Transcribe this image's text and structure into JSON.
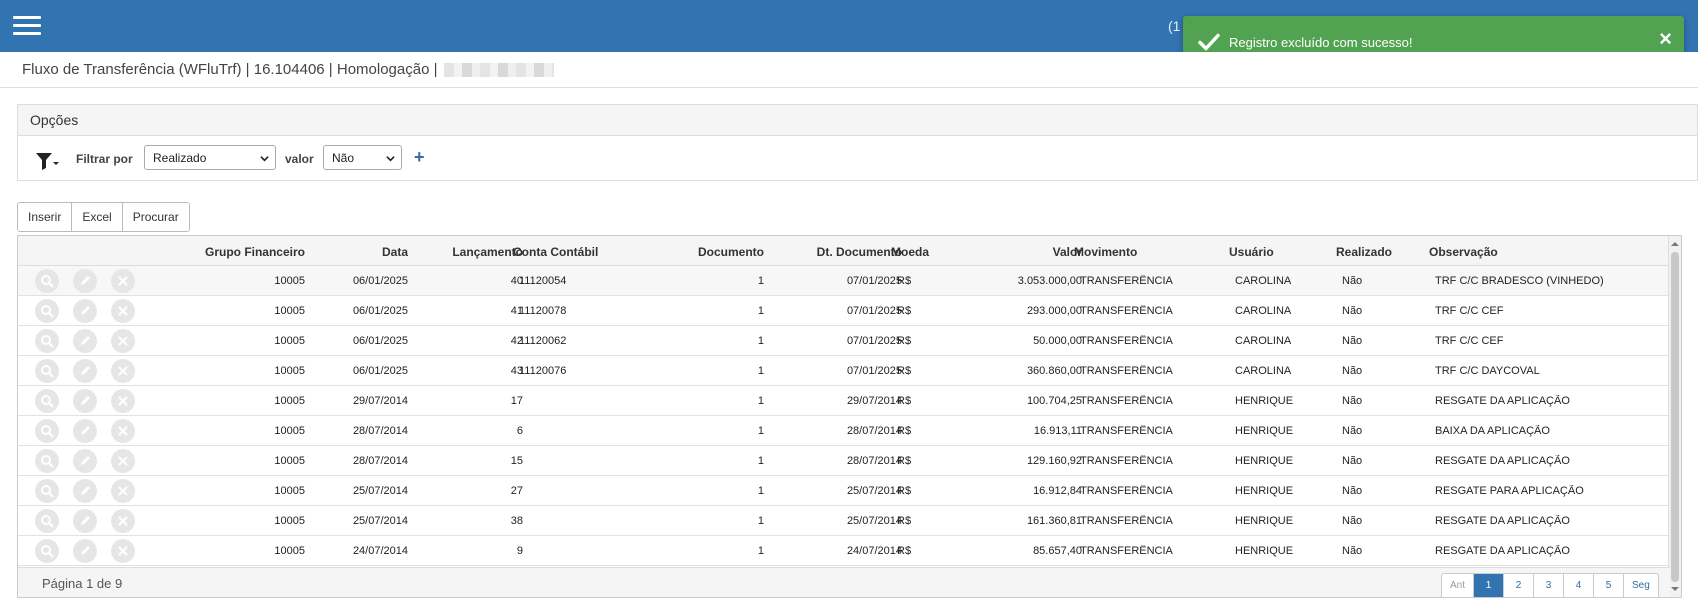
{
  "topbar": {
    "extra_text": "(1"
  },
  "toast": {
    "message": "Registro excluído com sucesso!",
    "close_label": "×",
    "color": "#51a351"
  },
  "page_title": "Fluxo de Transferência (WFluTrf) | 16.104406 | Homologação |",
  "options": {
    "heading": "Opções",
    "filter_label": "Filtrar por",
    "filter_field": "Realizado",
    "value_label": "valor",
    "filter_value": "Não",
    "add_label": "+"
  },
  "toolbar": {
    "insert_label": "Inserir",
    "excel_label": "Excel",
    "search_label": "Procurar"
  },
  "table": {
    "headers": {
      "grupo": "Grupo Financeiro",
      "data": "Data",
      "lancamento": "Lançamento",
      "conta": "Conta Contábil",
      "documento": "Documento",
      "dt_documento": "Dt. Documento",
      "moeda": "Moeda",
      "valor": "Valor",
      "movimento": "Movimento",
      "usuario": "Usuário",
      "realizado": "Realizado",
      "observacao": "Observação"
    },
    "rows": [
      {
        "grupo": "10005",
        "data": "06/01/2025",
        "lancamento": "40",
        "conta": "11120054",
        "documento": "1",
        "dt_documento": "07/01/2025",
        "moeda": "R$",
        "valor": "3.053.000,00",
        "movimento": "TRANSFERÊNCIA",
        "usuario": "CAROLINA",
        "realizado": "Não",
        "observacao": "TRF C/C BRADESCO (VINHEDO)"
      },
      {
        "grupo": "10005",
        "data": "06/01/2025",
        "lancamento": "41",
        "conta": "11120078",
        "documento": "1",
        "dt_documento": "07/01/2025",
        "moeda": "R$",
        "valor": "293.000,00",
        "movimento": "TRANSFERÊNCIA",
        "usuario": "CAROLINA",
        "realizado": "Não",
        "observacao": "TRF C/C CEF"
      },
      {
        "grupo": "10005",
        "data": "06/01/2025",
        "lancamento": "42",
        "conta": "11120062",
        "documento": "1",
        "dt_documento": "07/01/2025",
        "moeda": "R$",
        "valor": "50.000,00",
        "movimento": "TRANSFERÊNCIA",
        "usuario": "CAROLINA",
        "realizado": "Não",
        "observacao": "TRF C/C CEF"
      },
      {
        "grupo": "10005",
        "data": "06/01/2025",
        "lancamento": "43",
        "conta": "11120076",
        "documento": "1",
        "dt_documento": "07/01/2025",
        "moeda": "R$",
        "valor": "360.860,00",
        "movimento": "TRANSFERÊNCIA",
        "usuario": "CAROLINA",
        "realizado": "Não",
        "observacao": "TRF C/C DAYCOVAL"
      },
      {
        "grupo": "10005",
        "data": "29/07/2014",
        "lancamento": "17",
        "conta": "",
        "documento": "1",
        "dt_documento": "29/07/2014",
        "moeda": "R$",
        "valor": "100.704,25",
        "movimento": "TRANSFERÊNCIA",
        "usuario": "HENRIQUE",
        "realizado": "Não",
        "observacao": "RESGATE DA APLICAÇÃO"
      },
      {
        "grupo": "10005",
        "data": "28/07/2014",
        "lancamento": "6",
        "conta": "",
        "documento": "1",
        "dt_documento": "28/07/2014",
        "moeda": "R$",
        "valor": "16.913,11",
        "movimento": "TRANSFERÊNCIA",
        "usuario": "HENRIQUE",
        "realizado": "Não",
        "observacao": "BAIXA DA APLICAÇÃO"
      },
      {
        "grupo": "10005",
        "data": "28/07/2014",
        "lancamento": "15",
        "conta": "",
        "documento": "1",
        "dt_documento": "28/07/2014",
        "moeda": "R$",
        "valor": "129.160,92",
        "movimento": "TRANSFERÊNCIA",
        "usuario": "HENRIQUE",
        "realizado": "Não",
        "observacao": "RESGATE DA APLICAÇÃO"
      },
      {
        "grupo": "10005",
        "data": "25/07/2014",
        "lancamento": "27",
        "conta": "",
        "documento": "1",
        "dt_documento": "25/07/2014",
        "moeda": "R$",
        "valor": "16.912,84",
        "movimento": "TRANSFERÊNCIA",
        "usuario": "HENRIQUE",
        "realizado": "Não",
        "observacao": "RESGATE PARA APLICAÇÃO"
      },
      {
        "grupo": "10005",
        "data": "25/07/2014",
        "lancamento": "38",
        "conta": "",
        "documento": "1",
        "dt_documento": "25/07/2014",
        "moeda": "R$",
        "valor": "161.360,81",
        "movimento": "TRANSFERÊNCIA",
        "usuario": "HENRIQUE",
        "realizado": "Não",
        "observacao": "RESGATE DA APLICAÇÃO"
      },
      {
        "grupo": "10005",
        "data": "24/07/2014",
        "lancamento": "9",
        "conta": "",
        "documento": "1",
        "dt_documento": "24/07/2014",
        "moeda": "R$",
        "valor": "85.657,40",
        "movimento": "TRANSFERÊNCIA",
        "usuario": "HENRIQUE",
        "realizado": "Não",
        "observacao": "RESGATE DA APLICAÇÃO"
      }
    ]
  },
  "pagination": {
    "info": "Página 1 de 9",
    "prev_label": "Ant",
    "pages": [
      "1",
      "2",
      "3",
      "4",
      "5"
    ],
    "next_label": "Seg",
    "active": "1"
  },
  "colors": {
    "brand": "#3273b1",
    "success": "#51a351",
    "link": "#2f6da6"
  }
}
